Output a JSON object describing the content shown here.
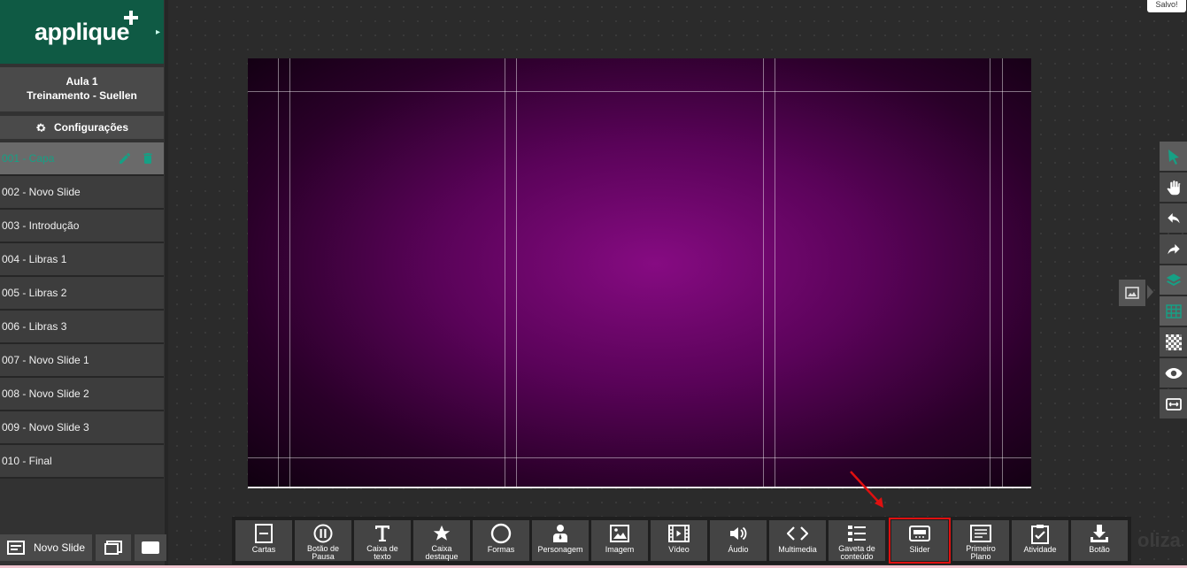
{
  "brand": {
    "logo_text": "applique",
    "colors": {
      "brand": "#0f5a44",
      "active_slide": "#16a085",
      "highlight": "#e01010"
    }
  },
  "course": {
    "title": "Aula 1",
    "subtitle": "Treinamento - Suellen"
  },
  "settings_label": "Configurações",
  "slides": [
    {
      "label": "001 - Capa",
      "active": true
    },
    {
      "label": "002 - Novo Slide"
    },
    {
      "label": "003 - Introdução"
    },
    {
      "label": "004 - Libras 1"
    },
    {
      "label": "005 - Libras 2"
    },
    {
      "label": "006 - Libras 3"
    },
    {
      "label": "007 - Novo Slide 1"
    },
    {
      "label": "008 - Novo Slide 2"
    },
    {
      "label": "009 - Novo Slide 3"
    },
    {
      "label": "010 - Final"
    }
  ],
  "footer": {
    "new_slide_label": "Novo Slide"
  },
  "status": {
    "saved": "Salvo!"
  },
  "watermark": "oliza",
  "toolbar": [
    {
      "id": "cartas",
      "label": "Cartas",
      "icon": "cards-icon"
    },
    {
      "id": "pausa",
      "label": "Botão de\nPausa",
      "icon": "pause-icon"
    },
    {
      "id": "texto",
      "label": "Caixa de\ntexto",
      "icon": "text-icon"
    },
    {
      "id": "destaque",
      "label": "Caixa\ndestaque",
      "icon": "star-icon"
    },
    {
      "id": "formas",
      "label": "Formas",
      "icon": "circle-icon"
    },
    {
      "id": "personagem",
      "label": "Personagem",
      "icon": "character-icon"
    },
    {
      "id": "imagem",
      "label": "Imagem",
      "icon": "image-icon"
    },
    {
      "id": "video",
      "label": "Vídeo",
      "icon": "film-icon"
    },
    {
      "id": "audio",
      "label": "Áudio",
      "icon": "speaker-icon"
    },
    {
      "id": "multimedia",
      "label": "Multimedia",
      "icon": "code-icon"
    },
    {
      "id": "gaveta",
      "label": "Gaveta de\nconteúdo",
      "icon": "list-icon"
    },
    {
      "id": "slider",
      "label": "Slider",
      "icon": "slider-icon",
      "highlighted": true
    },
    {
      "id": "primeiro",
      "label": "Primeiro\nPlano",
      "icon": "foreground-icon"
    },
    {
      "id": "atividade",
      "label": "Atividade",
      "icon": "clipboard-check-icon"
    },
    {
      "id": "botao",
      "label": "Botão",
      "icon": "download-icon"
    }
  ],
  "right_tools": [
    {
      "icon": "pointer-icon",
      "active": true
    },
    {
      "icon": "hand-icon"
    },
    {
      "icon": "undo-icon"
    },
    {
      "icon": "redo-icon"
    },
    {
      "icon": "layers-icon"
    },
    {
      "icon": "grid-icon"
    },
    {
      "icon": "checker-icon"
    },
    {
      "icon": "eye-icon"
    },
    {
      "icon": "fit-icon"
    }
  ]
}
